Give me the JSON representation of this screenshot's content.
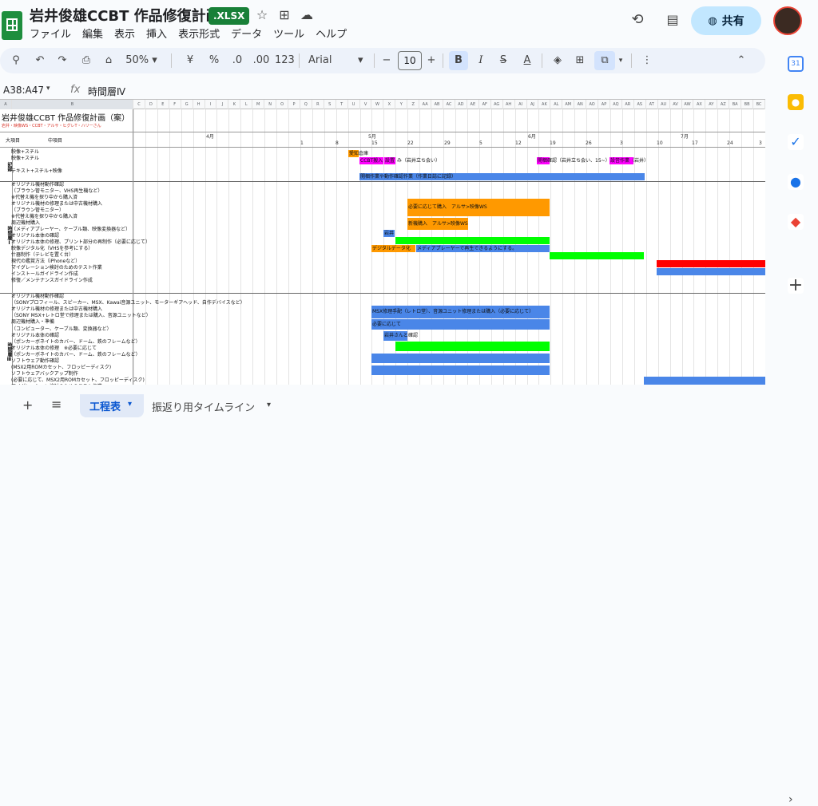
{
  "app": {
    "title": "岩井俊雄CCBT 作品修復計画",
    "file_badge": ".XLSX",
    "menu": [
      "ファイル",
      "編集",
      "表示",
      "挿入",
      "表示形式",
      "データ",
      "ツール",
      "ヘルプ"
    ],
    "share_label": "共有"
  },
  "toolbar": {
    "zoom": "50%",
    "currency": "¥",
    "percent": "%",
    "dec_less": ".0",
    "dec_more": ".00",
    "number_format": "123",
    "font": "Arial",
    "font_size": "10"
  },
  "formula_bar": {
    "name_box": "A38:A47",
    "fx": "fx",
    "value": "時間層Ⅳ"
  },
  "sheet": {
    "columns": [
      "A",
      "B",
      "C",
      "D",
      "E",
      "F",
      "G",
      "H",
      "I",
      "J",
      "K",
      "L",
      "M",
      "N",
      "O",
      "P",
      "Q",
      "R",
      "S",
      "T",
      "U",
      "V",
      "W",
      "X",
      "Y",
      "Z",
      "AA",
      "AB",
      "AC",
      "AD",
      "AE",
      "AF",
      "AG",
      "AH",
      "AI",
      "AJ",
      "AK",
      "AL",
      "AM",
      "AN",
      "AO",
      "AP",
      "AQ",
      "AR",
      "AS",
      "AT",
      "AU",
      "AV",
      "AW",
      "AX",
      "AY",
      "AZ",
      "BA",
      "BB",
      "BC"
    ],
    "title": "岩井俊雄CCBT 作品修復計画（案）",
    "legend": "岩井・映像WS・CCBT・アルサ・ヒグレT・ハリーさん",
    "header_item": "大項目",
    "header_sub": "中項目",
    "months": [
      "4月",
      "5月",
      "6月",
      "7月"
    ],
    "days": [
      "1",
      "8",
      "15",
      "22",
      "29",
      "5",
      "12",
      "19",
      "26",
      "3",
      "10",
      "17",
      "24",
      "3"
    ],
    "sections": [
      "記録",
      "時間層Ⅰ",
      "時間層Ⅲ"
    ],
    "rows": [
      "映像+スチル",
      "映像+スチル",
      "",
      "テキスト+スチル+映像",
      "オリジナル機材動作確認",
      "（ブラウン管モニター、VHS再生機など）",
      "※代替え機を探り中から購入済",
      "オリジナル機材の修理または中古機材購入",
      "（ブラウン管モニター）",
      "※代替え機を探り中から購入済",
      "周辺機材購入",
      "（メディアプレーヤー、ケーブル類、映像変換器など）",
      "オリジナル本体の確認",
      "オリジナル本体の修理、プリント部分の再制作（必要に応じて）",
      "映像デジタル化（VHSを参考にする）",
      "什器制作（テレビを置く台）",
      "現代の鑑賞方法（iPhoneなど）",
      "マイグレーション検討のためのテスト作業",
      "インストールガイドライン作成",
      "修復／メンテナンスガイドライン作成",
      "オリジナル機材動作確認",
      "（SONYプロフィール、スピーカー、MSX、Kawai音源ユニット、モーターギアヘッド、自作デバイスなど）",
      "オリジナル機材の修理または中古機材購入",
      "（SONY MSX+レトロ堂で修理または購入、音源ユニットなど）",
      "周辺機材購入・準備",
      "（コンピューター、ケーブル類、変換器など）",
      "オリジナル本体の確認",
      "（ポンカーボネイトのカバー、ドーム、鉄のフレームなど）",
      "オリジナル本体の修理　※必要に応じて",
      "（ポンカーボネイトのカバー、ドーム、鉄のフレームなど）",
      "ソフトウェア動作確認",
      "(MSX2用ROMカセット、フロッピーディスク)",
      "ソフトウェアバックアップ制作",
      "(必要に応じて、MSX2用ROMカセット、フロッピーディスク)",
      "マイグレーション検討のためのテスト作業"
    ],
    "bar_labels": {
      "b1": "愛知倉庫",
      "b2": "CCBT搬入",
      "b3": "設置",
      "b4": "み（岩井立ち会い）",
      "b5": "開梱確認（岩井立ち会い、15~）",
      "b6": "設営作業（岩井）",
      "b7": "開梱作業や動作確認作業（作業日誌に記録）",
      "b8": "必要に応じて購入　アルサ>映像WS",
      "b9": "新機購入　アルサ>映像WS",
      "b10": "岩井",
      "b11": "デジタルデータ化",
      "b12": "メディアプレーヤーで再生できるようにする。",
      "b13": "MSX修理手配（レトロ堂）、音源ユニット修理または購入（必要に応じて）",
      "b14": "必要に応じて",
      "b15": "岩井さんと確認"
    }
  }
}
